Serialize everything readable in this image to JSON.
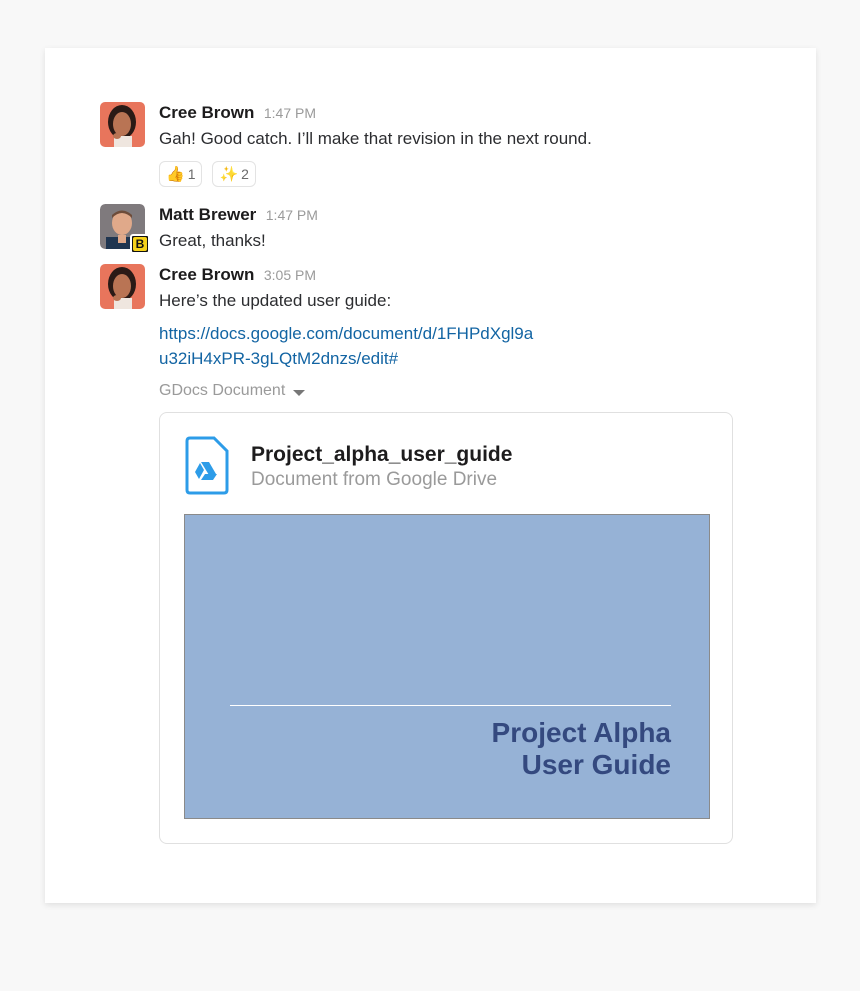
{
  "messages": [
    {
      "author": "Cree Brown",
      "time": "1:47 PM",
      "text": "Gah! Good catch. I’ll make that revision in the next round.",
      "reactions": [
        {
          "emoji": "👍",
          "count": "1"
        },
        {
          "emoji": "✨",
          "count": "2"
        }
      ]
    },
    {
      "author": "Matt Brewer",
      "time": "1:47 PM",
      "text": "Great, thanks!",
      "badge": "B"
    },
    {
      "author": "Cree Brown",
      "time": "3:05 PM",
      "text": "Here’s the updated user guide:",
      "link": "https://docs.google.com/document/d/1FHPdXgl9au32iH4xPR-3gLQtM2dnzs/edit#",
      "attachment_label": "GDocs Document",
      "attachment": {
        "title": "Project_alpha_user_guide",
        "subtitle": "Document from Google Drive",
        "preview_title_line1": "Project Alpha",
        "preview_title_line2": "User Guide"
      }
    }
  ],
  "colors": {
    "link": "#1264a3",
    "preview_bg": "#96b2d6",
    "preview_title": "#34497f",
    "drive_icon": "#2d9ce8"
  }
}
